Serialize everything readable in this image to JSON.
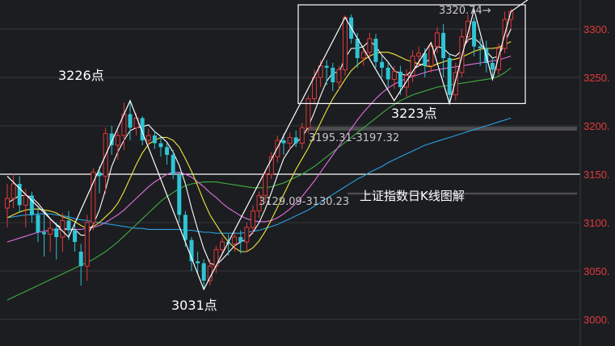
{
  "chart_data": {
    "type": "candlestick",
    "title": "上证指数日K线图解",
    "y_axis": {
      "ticks": [
        3000,
        3050,
        3100,
        3150,
        3200,
        3250,
        3300
      ],
      "tick_labels": [
        "3000.",
        "3050.",
        "3100.",
        "3150.",
        "3200.",
        "3250.",
        "3300."
      ],
      "range": [
        2990,
        3325
      ],
      "tick_color": "#e03a3a",
      "grid": true
    },
    "annotations": {
      "high_left": "3226点",
      "low": "3031点",
      "box_low": "3223点",
      "gap_upper": "3195.31-3197.32",
      "gap_lower": "3129.09-3130.23",
      "last_high": "3320.74→"
    },
    "levels": {
      "support_line": 3150,
      "gap_upper_band": [
        3195.31,
        3197.32
      ],
      "gap_lower_band": [
        3129.09,
        3130.23
      ]
    },
    "colors": {
      "up": "#e03a3a",
      "down": "#2ec4d4",
      "ma5": "#ffffff",
      "ma10": "#f2e63a",
      "ma20": "#e070e0",
      "ma30": "#3fae3f",
      "ma60": "#2a9fe0"
    },
    "candles": [
      [
        3115,
        3125,
        3095,
        3140
      ],
      [
        3125,
        3140,
        3115,
        3150
      ],
      [
        3140,
        3118,
        3110,
        3148
      ],
      [
        3118,
        3128,
        3095,
        3135
      ],
      [
        3128,
        3108,
        3100,
        3132
      ],
      [
        3108,
        3090,
        3080,
        3115
      ],
      [
        3090,
        3088,
        3065,
        3112
      ],
      [
        3088,
        3094,
        3070,
        3105
      ],
      [
        3094,
        3085,
        3062,
        3100
      ],
      [
        3085,
        3102,
        3070,
        3110
      ],
      [
        3102,
        3092,
        3082,
        3112
      ],
      [
        3092,
        3080,
        3070,
        3098
      ],
      [
        3070,
        3055,
        3035,
        3078
      ],
      [
        3055,
        3100,
        3040,
        3108
      ],
      [
        3100,
        3152,
        3092,
        3156
      ],
      [
        3152,
        3148,
        3130,
        3158
      ],
      [
        3148,
        3192,
        3130,
        3198
      ],
      [
        3192,
        3180,
        3170,
        3200
      ],
      [
        3180,
        3190,
        3165,
        3195
      ],
      [
        3190,
        3212,
        3175,
        3224
      ],
      [
        3212,
        3198,
        3185,
        3226
      ],
      [
        3198,
        3208,
        3190,
        3213
      ],
      [
        3208,
        3185,
        3180,
        3210
      ],
      [
        3185,
        3190,
        3180,
        3197
      ],
      [
        3190,
        3182,
        3176,
        3195
      ],
      [
        3182,
        3178,
        3168,
        3188
      ],
      [
        3178,
        3170,
        3160,
        3182
      ],
      [
        3170,
        3150,
        3145,
        3175
      ],
      [
        3150,
        3108,
        3100,
        3152
      ],
      [
        3108,
        3082,
        3075,
        3112
      ],
      [
        3082,
        3060,
        3050,
        3085
      ],
      [
        3060,
        3058,
        3048,
        3070
      ],
      [
        3058,
        3040,
        3031,
        3062
      ],
      [
        3040,
        3055,
        3035,
        3062
      ],
      [
        3055,
        3072,
        3048,
        3076
      ],
      [
        3072,
        3080,
        3068,
        3085
      ],
      [
        3080,
        3078,
        3066,
        3088
      ],
      [
        3078,
        3085,
        3070,
        3090
      ],
      [
        3085,
        3080,
        3068,
        3092
      ],
      [
        3080,
        3095,
        3070,
        3100
      ],
      [
        3095,
        3112,
        3088,
        3118
      ],
      [
        3112,
        3128,
        3105,
        3132
      ],
      [
        3128,
        3150,
        3120,
        3154
      ],
      [
        3150,
        3168,
        3145,
        3173
      ],
      [
        3168,
        3185,
        3162,
        3190
      ],
      [
        3185,
        3182,
        3170,
        3192
      ],
      [
        3182,
        3188,
        3175,
        3193
      ],
      [
        3188,
        3182,
        3178,
        3195
      ],
      [
        3182,
        3198,
        3176,
        3203
      ],
      [
        3198,
        3228,
        3192,
        3232
      ],
      [
        3228,
        3250,
        3222,
        3258
      ],
      [
        3250,
        3262,
        3240,
        3268
      ],
      [
        3262,
        3260,
        3242,
        3268
      ],
      [
        3260,
        3245,
        3236,
        3265
      ],
      [
        3245,
        3258,
        3238,
        3262
      ],
      [
        3258,
        3312,
        3252,
        3314
      ],
      [
        3312,
        3290,
        3285,
        3315
      ],
      [
        3290,
        3270,
        3260,
        3296
      ],
      [
        3270,
        3276,
        3262,
        3280
      ],
      [
        3276,
        3290,
        3270,
        3296
      ],
      [
        3290,
        3266,
        3260,
        3295
      ],
      [
        3266,
        3260,
        3250,
        3272
      ],
      [
        3260,
        3248,
        3240,
        3265
      ],
      [
        3248,
        3256,
        3238,
        3262
      ],
      [
        3256,
        3240,
        3232,
        3262
      ],
      [
        3240,
        3252,
        3230,
        3258
      ],
      [
        3252,
        3272,
        3245,
        3278
      ],
      [
        3272,
        3275,
        3262,
        3282
      ],
      [
        3275,
        3262,
        3250,
        3280
      ],
      [
        3262,
        3282,
        3255,
        3286
      ],
      [
        3282,
        3296,
        3275,
        3302
      ],
      [
        3296,
        3270,
        3250,
        3305
      ],
      [
        3270,
        3232,
        3223,
        3275
      ],
      [
        3232,
        3255,
        3226,
        3265
      ],
      [
        3255,
        3292,
        3250,
        3300
      ],
      [
        3292,
        3308,
        3286,
        3315
      ],
      [
        3308,
        3282,
        3272,
        3312
      ],
      [
        3282,
        3280,
        3262,
        3290
      ],
      [
        3280,
        3265,
        3255,
        3288
      ],
      [
        3265,
        3258,
        3248,
        3270
      ],
      [
        3258,
        3280,
        3252,
        3285
      ],
      [
        3280,
        3310,
        3275,
        3318
      ],
      [
        3310,
        3318,
        3300,
        3321
      ]
    ],
    "ma5": [
      3120,
      3124,
      3128,
      3128,
      3126,
      3120,
      3112,
      3104,
      3098,
      3094,
      3093,
      3093,
      3087,
      3087,
      3098,
      3113,
      3134,
      3158,
      3173,
      3185,
      3195,
      3198,
      3199,
      3201,
      3194,
      3189,
      3183,
      3173,
      3159,
      3140,
      3115,
      3093,
      3073,
      3058,
      3056,
      3062,
      3069,
      3076,
      3080,
      3083,
      3090,
      3100,
      3114,
      3131,
      3149,
      3166,
      3176,
      3183,
      3188,
      3199,
      3214,
      3231,
      3246,
      3255,
      3255,
      3270,
      3280,
      3280,
      3282,
      3288,
      3282,
      3273,
      3266,
      3257,
      3254,
      3252,
      3258,
      3262,
      3265,
      3270,
      3282,
      3280,
      3274,
      3272,
      3278,
      3289,
      3291,
      3285,
      3277,
      3270,
      3272,
      3286,
      3300
    ],
    "ma10": [
      3105,
      3108,
      3111,
      3113,
      3114,
      3114,
      3113,
      3112,
      3110,
      3106,
      3104,
      3101,
      3097,
      3094,
      3096,
      3100,
      3106,
      3112,
      3120,
      3132,
      3146,
      3160,
      3172,
      3181,
      3185,
      3188,
      3188,
      3185,
      3178,
      3166,
      3153,
      3138,
      3122,
      3108,
      3098,
      3088,
      3080,
      3074,
      3070,
      3070,
      3074,
      3081,
      3091,
      3103,
      3116,
      3129,
      3142,
      3155,
      3166,
      3177,
      3190,
      3203,
      3216,
      3228,
      3238,
      3248,
      3257,
      3263,
      3268,
      3272,
      3275,
      3276,
      3276,
      3274,
      3271,
      3268,
      3266,
      3264,
      3262,
      3261,
      3264,
      3266,
      3268,
      3269,
      3271,
      3274,
      3277,
      3279,
      3280,
      3280,
      3281,
      3284,
      3287
    ],
    "ma20": [
      3080,
      3082,
      3084,
      3086,
      3088,
      3090,
      3091,
      3092,
      3093,
      3093,
      3093,
      3093,
      3093,
      3094,
      3095,
      3097,
      3100,
      3104,
      3108,
      3113,
      3119,
      3125,
      3131,
      3137,
      3142,
      3146,
      3150,
      3152,
      3152,
      3150,
      3147,
      3142,
      3137,
      3131,
      3126,
      3120,
      3115,
      3111,
      3107,
      3104,
      3102,
      3101,
      3101,
      3102,
      3105,
      3109,
      3114,
      3120,
      3127,
      3135,
      3143,
      3152,
      3161,
      3170,
      3179,
      3188,
      3197,
      3206,
      3214,
      3221,
      3228,
      3234,
      3239,
      3243,
      3246,
      3249,
      3251,
      3253,
      3255,
      3257,
      3258,
      3259,
      3260,
      3261,
      3262,
      3263,
      3264,
      3265,
      3266,
      3267,
      3268,
      3270,
      3272
    ],
    "ma30": [
      3020,
      3023,
      3026,
      3029,
      3032,
      3035,
      3038,
      3041,
      3044,
      3047,
      3050,
      3053,
      3056,
      3059,
      3062,
      3066,
      3070,
      3075,
      3080,
      3086,
      3092,
      3098,
      3104,
      3110,
      3116,
      3122,
      3127,
      3131,
      3135,
      3138,
      3140,
      3141,
      3142,
      3142,
      3142,
      3141,
      3140,
      3139,
      3138,
      3137,
      3136,
      3136,
      3136,
      3137,
      3139,
      3141,
      3144,
      3147,
      3150,
      3154,
      3158,
      3163,
      3168,
      3173,
      3178,
      3183,
      3188,
      3193,
      3198,
      3203,
      3208,
      3213,
      3218,
      3222,
      3226,
      3229,
      3232,
      3234,
      3236,
      3238,
      3240,
      3241,
      3242,
      3243,
      3244,
      3245,
      3246,
      3247,
      3248,
      3249,
      3251,
      3255,
      3260
    ],
    "ma60": [
      3105,
      3106,
      3107,
      3108,
      3108,
      3109,
      3109,
      3109,
      3108,
      3107,
      3106,
      3104,
      3103,
      3102,
      3101,
      3100,
      3099,
      3098,
      3097,
      3096,
      3095,
      3094,
      3094,
      3093,
      3093,
      3093,
      3093,
      3093,
      3093,
      3092,
      3092,
      3091,
      3090,
      3090,
      3089,
      3089,
      3089,
      3089,
      3089,
      3090,
      3091,
      3092,
      3094,
      3096,
      3098,
      3101,
      3104,
      3107,
      3110,
      3113,
      3117,
      3121,
      3125,
      3129,
      3133,
      3137,
      3141,
      3145,
      3148,
      3152,
      3155,
      3158,
      3162,
      3165,
      3168,
      3171,
      3174,
      3177,
      3180,
      3182,
      3184,
      3186,
      3188,
      3190,
      3192,
      3194,
      3196,
      3198,
      3200,
      3202,
      3204,
      3206,
      3208
    ]
  }
}
